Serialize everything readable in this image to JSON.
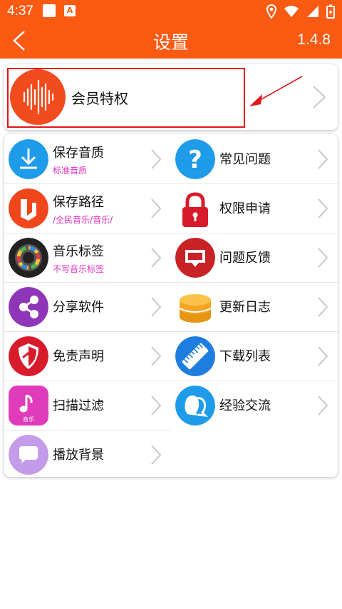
{
  "status": {
    "time": "4:37",
    "notif_letter": "A"
  },
  "header": {
    "title": "设置",
    "version": "1.4.8"
  },
  "vip": {
    "label": "会员特权"
  },
  "items": [
    {
      "title": "保存音质",
      "subtitle": "标准音质",
      "icon": "download-icon",
      "color": "#1e9be9"
    },
    {
      "title": "常见问题",
      "subtitle": "",
      "icon": "question-icon",
      "color": "#1e9be9"
    },
    {
      "title": "保存路径",
      "subtitle": "/全民音乐/音乐/",
      "icon": "folder-path-icon",
      "color": "#f0461c"
    },
    {
      "title": "权限申请",
      "subtitle": "",
      "icon": "lock-icon",
      "color": "#d81b2b"
    },
    {
      "title": "音乐标签",
      "subtitle": "不写音乐标签",
      "icon": "music-tag-icon",
      "color": "#222222"
    },
    {
      "title": "问题反馈",
      "subtitle": "",
      "icon": "feedback-icon",
      "color": "#c72226"
    },
    {
      "title": "分享软件",
      "subtitle": "",
      "icon": "share-icon",
      "color": "#8e35b8"
    },
    {
      "title": "更新日志",
      "subtitle": "",
      "icon": "update-log-icon",
      "color": "#f6a623"
    },
    {
      "title": "免责声明",
      "subtitle": "",
      "icon": "shield-icon",
      "color": "#d81b2b"
    },
    {
      "title": "下载列表",
      "subtitle": "",
      "icon": "ruler-list-icon",
      "color": "#1e7ee0"
    },
    {
      "title": "扫描过滤",
      "subtitle": "",
      "icon": "music-note-icon",
      "color": "#e03bbb"
    },
    {
      "title": "经验交流",
      "subtitle": "",
      "icon": "chat-group-icon",
      "color": "#1e9be9"
    },
    {
      "title": "播放背景",
      "subtitle": "",
      "icon": "message-bubble-icon",
      "color": "#c49be8"
    }
  ],
  "colors": {
    "accent": "#fb5a13",
    "highlight": "#e5141b",
    "subtitle": "#e02fbf"
  }
}
